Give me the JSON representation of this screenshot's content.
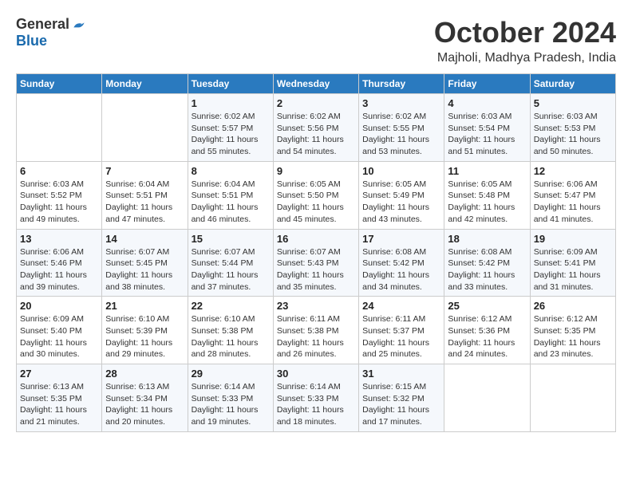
{
  "logo": {
    "general": "General",
    "blue": "Blue"
  },
  "title": {
    "month": "October 2024",
    "location": "Majholi, Madhya Pradesh, India"
  },
  "weekdays": [
    "Sunday",
    "Monday",
    "Tuesday",
    "Wednesday",
    "Thursday",
    "Friday",
    "Saturday"
  ],
  "weeks": [
    [
      {
        "day": "",
        "info": ""
      },
      {
        "day": "",
        "info": ""
      },
      {
        "day": "1",
        "info": "Sunrise: 6:02 AM\nSunset: 5:57 PM\nDaylight: 11 hours and 55 minutes."
      },
      {
        "day": "2",
        "info": "Sunrise: 6:02 AM\nSunset: 5:56 PM\nDaylight: 11 hours and 54 minutes."
      },
      {
        "day": "3",
        "info": "Sunrise: 6:02 AM\nSunset: 5:55 PM\nDaylight: 11 hours and 53 minutes."
      },
      {
        "day": "4",
        "info": "Sunrise: 6:03 AM\nSunset: 5:54 PM\nDaylight: 11 hours and 51 minutes."
      },
      {
        "day": "5",
        "info": "Sunrise: 6:03 AM\nSunset: 5:53 PM\nDaylight: 11 hours and 50 minutes."
      }
    ],
    [
      {
        "day": "6",
        "info": "Sunrise: 6:03 AM\nSunset: 5:52 PM\nDaylight: 11 hours and 49 minutes."
      },
      {
        "day": "7",
        "info": "Sunrise: 6:04 AM\nSunset: 5:51 PM\nDaylight: 11 hours and 47 minutes."
      },
      {
        "day": "8",
        "info": "Sunrise: 6:04 AM\nSunset: 5:51 PM\nDaylight: 11 hours and 46 minutes."
      },
      {
        "day": "9",
        "info": "Sunrise: 6:05 AM\nSunset: 5:50 PM\nDaylight: 11 hours and 45 minutes."
      },
      {
        "day": "10",
        "info": "Sunrise: 6:05 AM\nSunset: 5:49 PM\nDaylight: 11 hours and 43 minutes."
      },
      {
        "day": "11",
        "info": "Sunrise: 6:05 AM\nSunset: 5:48 PM\nDaylight: 11 hours and 42 minutes."
      },
      {
        "day": "12",
        "info": "Sunrise: 6:06 AM\nSunset: 5:47 PM\nDaylight: 11 hours and 41 minutes."
      }
    ],
    [
      {
        "day": "13",
        "info": "Sunrise: 6:06 AM\nSunset: 5:46 PM\nDaylight: 11 hours and 39 minutes."
      },
      {
        "day": "14",
        "info": "Sunrise: 6:07 AM\nSunset: 5:45 PM\nDaylight: 11 hours and 38 minutes."
      },
      {
        "day": "15",
        "info": "Sunrise: 6:07 AM\nSunset: 5:44 PM\nDaylight: 11 hours and 37 minutes."
      },
      {
        "day": "16",
        "info": "Sunrise: 6:07 AM\nSunset: 5:43 PM\nDaylight: 11 hours and 35 minutes."
      },
      {
        "day": "17",
        "info": "Sunrise: 6:08 AM\nSunset: 5:42 PM\nDaylight: 11 hours and 34 minutes."
      },
      {
        "day": "18",
        "info": "Sunrise: 6:08 AM\nSunset: 5:42 PM\nDaylight: 11 hours and 33 minutes."
      },
      {
        "day": "19",
        "info": "Sunrise: 6:09 AM\nSunset: 5:41 PM\nDaylight: 11 hours and 31 minutes."
      }
    ],
    [
      {
        "day": "20",
        "info": "Sunrise: 6:09 AM\nSunset: 5:40 PM\nDaylight: 11 hours and 30 minutes."
      },
      {
        "day": "21",
        "info": "Sunrise: 6:10 AM\nSunset: 5:39 PM\nDaylight: 11 hours and 29 minutes."
      },
      {
        "day": "22",
        "info": "Sunrise: 6:10 AM\nSunset: 5:38 PM\nDaylight: 11 hours and 28 minutes."
      },
      {
        "day": "23",
        "info": "Sunrise: 6:11 AM\nSunset: 5:38 PM\nDaylight: 11 hours and 26 minutes."
      },
      {
        "day": "24",
        "info": "Sunrise: 6:11 AM\nSunset: 5:37 PM\nDaylight: 11 hours and 25 minutes."
      },
      {
        "day": "25",
        "info": "Sunrise: 6:12 AM\nSunset: 5:36 PM\nDaylight: 11 hours and 24 minutes."
      },
      {
        "day": "26",
        "info": "Sunrise: 6:12 AM\nSunset: 5:35 PM\nDaylight: 11 hours and 23 minutes."
      }
    ],
    [
      {
        "day": "27",
        "info": "Sunrise: 6:13 AM\nSunset: 5:35 PM\nDaylight: 11 hours and 21 minutes."
      },
      {
        "day": "28",
        "info": "Sunrise: 6:13 AM\nSunset: 5:34 PM\nDaylight: 11 hours and 20 minutes."
      },
      {
        "day": "29",
        "info": "Sunrise: 6:14 AM\nSunset: 5:33 PM\nDaylight: 11 hours and 19 minutes."
      },
      {
        "day": "30",
        "info": "Sunrise: 6:14 AM\nSunset: 5:33 PM\nDaylight: 11 hours and 18 minutes."
      },
      {
        "day": "31",
        "info": "Sunrise: 6:15 AM\nSunset: 5:32 PM\nDaylight: 11 hours and 17 minutes."
      },
      {
        "day": "",
        "info": ""
      },
      {
        "day": "",
        "info": ""
      }
    ]
  ]
}
